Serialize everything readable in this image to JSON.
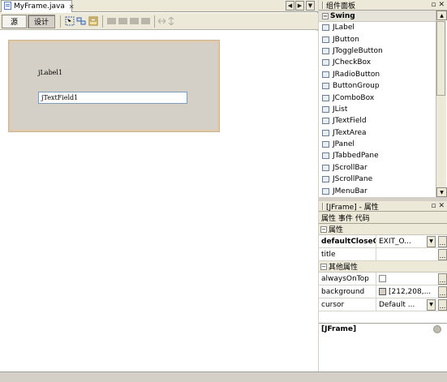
{
  "editor": {
    "file_tab": "MyFrame.java",
    "close_glyph": "✕",
    "nav": [
      "◀",
      "▶",
      "▼"
    ],
    "mode_source": "源",
    "mode_design": "设计",
    "jlabel_text": "jLabel1",
    "jtextfield_text": "jTextField1"
  },
  "palette": {
    "title": "组件面板",
    "category": "Swing",
    "items": [
      "JLabel",
      "JButton",
      "JToggleButton",
      "JCheckBox",
      "JRadioButton",
      "ButtonGroup",
      "JComboBox",
      "JList",
      "JTextField",
      "JTextArea",
      "JPanel",
      "JTabbedPane",
      "JScrollBar",
      "JScrollPane",
      "JMenuBar"
    ]
  },
  "properties": {
    "title": "[JFrame] - 属性",
    "tabs": "属性 事件 代码",
    "section1": "属性",
    "section2": "其他属性",
    "rows1": [
      {
        "key": "defaultCloseOpe",
        "value": "EXIT_O..."
      },
      {
        "key": "title",
        "value": ""
      }
    ],
    "rows2": [
      {
        "key": "alwaysOnTop",
        "value": ""
      },
      {
        "key": "background",
        "value": "[212,208,..."
      },
      {
        "key": "cursor",
        "value": "Default ..."
      }
    ],
    "footer": "[JFrame]"
  }
}
